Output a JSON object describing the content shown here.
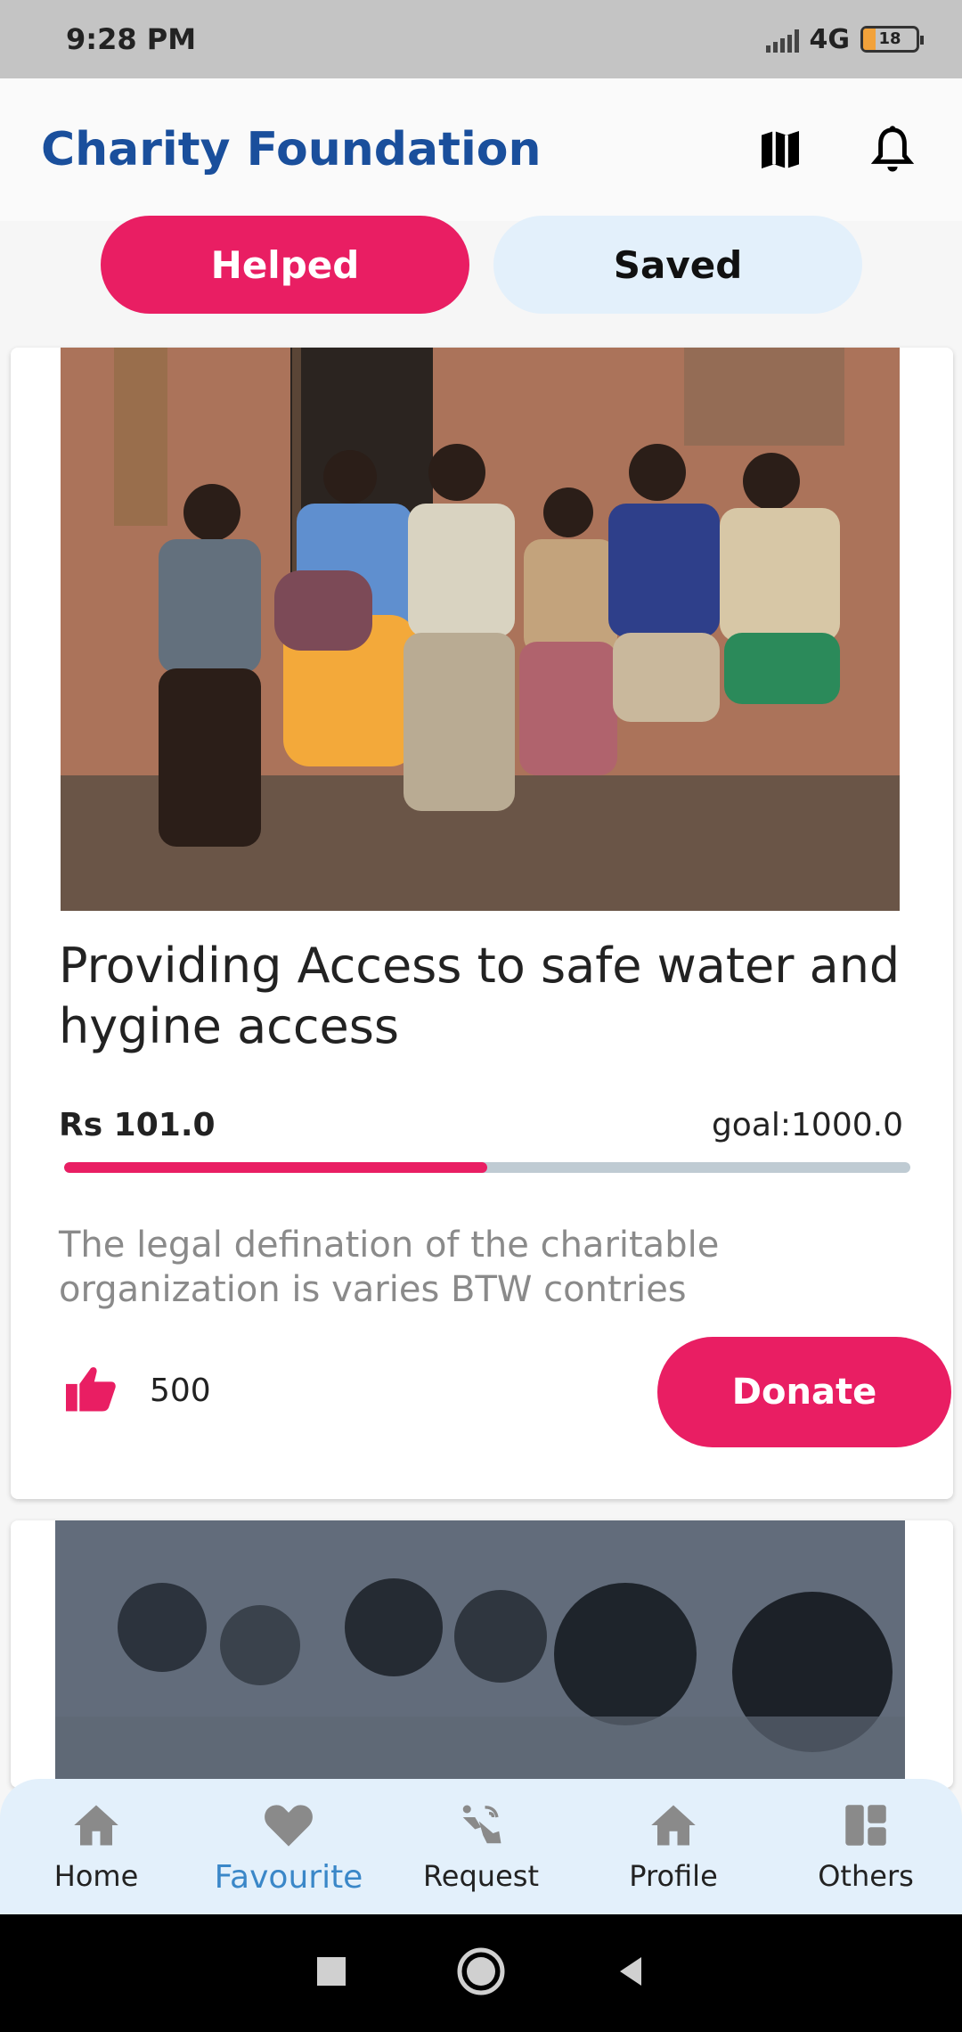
{
  "status_bar": {
    "time": "9:28 PM",
    "network": "4G",
    "battery": "18"
  },
  "app_bar": {
    "title": "Charity Foundation",
    "map_icon": "map-icon",
    "bell_icon": "bell-icon"
  },
  "tabs": {
    "helped": "Helped",
    "saved": "Saved"
  },
  "card": {
    "title": "Providing Access to safe water and hygine access",
    "raised": "Rs 101.0",
    "goal": "goal:1000.0",
    "progress": 0.5,
    "description": "The legal defination of the charitable organization is varies BTW contries",
    "likes": "500",
    "donate_label": "Donate"
  },
  "bottom_nav": {
    "home": "Home",
    "favourite": "Favourite",
    "request": "Request",
    "profile": "Profile",
    "others": "Others"
  },
  "colors": {
    "accent": "#e91e63",
    "title": "#1a4f9c",
    "nav_bg": "#e3f0fb",
    "active_nav": "#3a87c8"
  }
}
